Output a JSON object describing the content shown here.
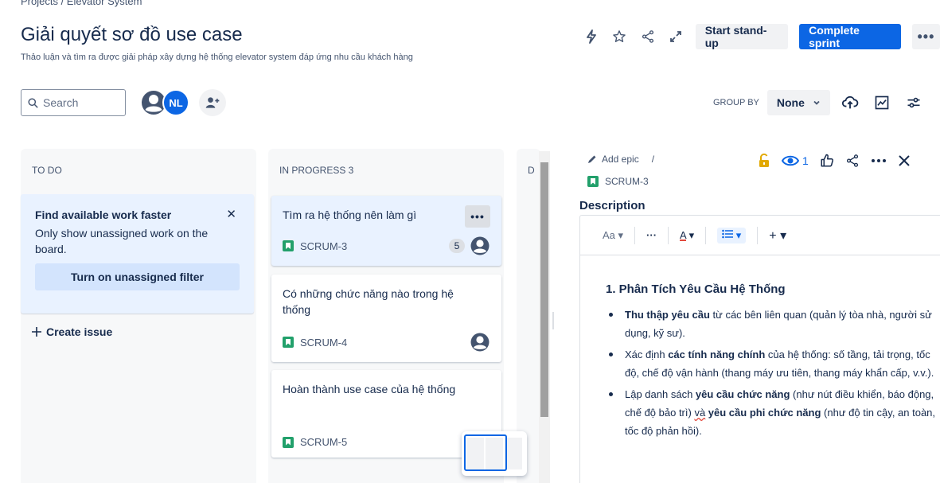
{
  "header": {
    "breadcrumb": "Projects  /  Elevator System",
    "title": "Giải quyết sơ đồ use case",
    "subtitle": "Thảo luận và tìm ra được giải pháp xây dựng hệ thống elevator system đáp ứng nhu cầu khách hàng",
    "actions": {
      "icons": [
        "lightning-icon",
        "star-icon",
        "share-icon",
        "expand-icon"
      ],
      "standup_label": "Start stand-up",
      "complete_label": "Complete sprint",
      "more_label": "•••"
    }
  },
  "toolbar": {
    "search_placeholder": "Search",
    "avatars": [
      {
        "type": "generic"
      },
      {
        "initials": "NL"
      }
    ],
    "groupby_label": "GROUP BY",
    "groupby_value": "None"
  },
  "columns": [
    {
      "header": "TO DO",
      "tip": {
        "title": "Find available work faster",
        "text": "Only show unassigned work on the board.",
        "button": "Turn on unassigned filter"
      },
      "create_label": "Create issue"
    },
    {
      "header": "IN PROGRESS 3",
      "cards": [
        {
          "title": "Tìm ra hệ thống nên làm gì",
          "key": "SCRUM-3",
          "points": "5",
          "more": "•••"
        },
        {
          "title": "Có những chức năng nào trong hệ thống",
          "key": "SCRUM-4"
        },
        {
          "title": "Hoàn thành use case của hệ thống",
          "key": "SCRUM-5"
        }
      ]
    },
    {
      "header": "D"
    }
  ],
  "detail": {
    "add_epic": "Add epic",
    "separator": "/",
    "key": "SCRUM-3",
    "watchers": "1",
    "description_label": "Description",
    "editor_toolbar": {
      "text_style": "Aa",
      "more": "···",
      "color": "A",
      "plus": "+"
    },
    "content": {
      "heading": "1. Phân Tích Yêu Cầu Hệ Thống",
      "items": [
        {
          "bold": "Thu thập yêu cầu",
          "rest": " từ các bên liên quan (quản lý tòa nhà, người sử dụng, kỹ sư)."
        },
        {
          "pre": "Xác định ",
          "bold": "các tính năng chính",
          "rest": " của hệ thống: số tầng, tải trọng, tốc độ, chế độ vận hành (thang máy ưu tiên, thang máy khẩn cấp, v.v.)."
        },
        {
          "pre": "Lập danh sách ",
          "bold": "yêu cầu chức năng",
          "mid": " (như nút điều khiển, báo động, chế độ bảo trì) ",
          "squiggle": "và",
          "bold2": " yêu cầu phi chức năng",
          "rest": " (như độ tin cậy, an toàn, tốc độ phản hồi)."
        }
      ]
    }
  },
  "colors": {
    "primary": "#0c66e4",
    "column_bg": "#f7f8f9",
    "tip_bg": "#e9f2ff",
    "story": "#22a06b",
    "lock": "#e2a900"
  }
}
